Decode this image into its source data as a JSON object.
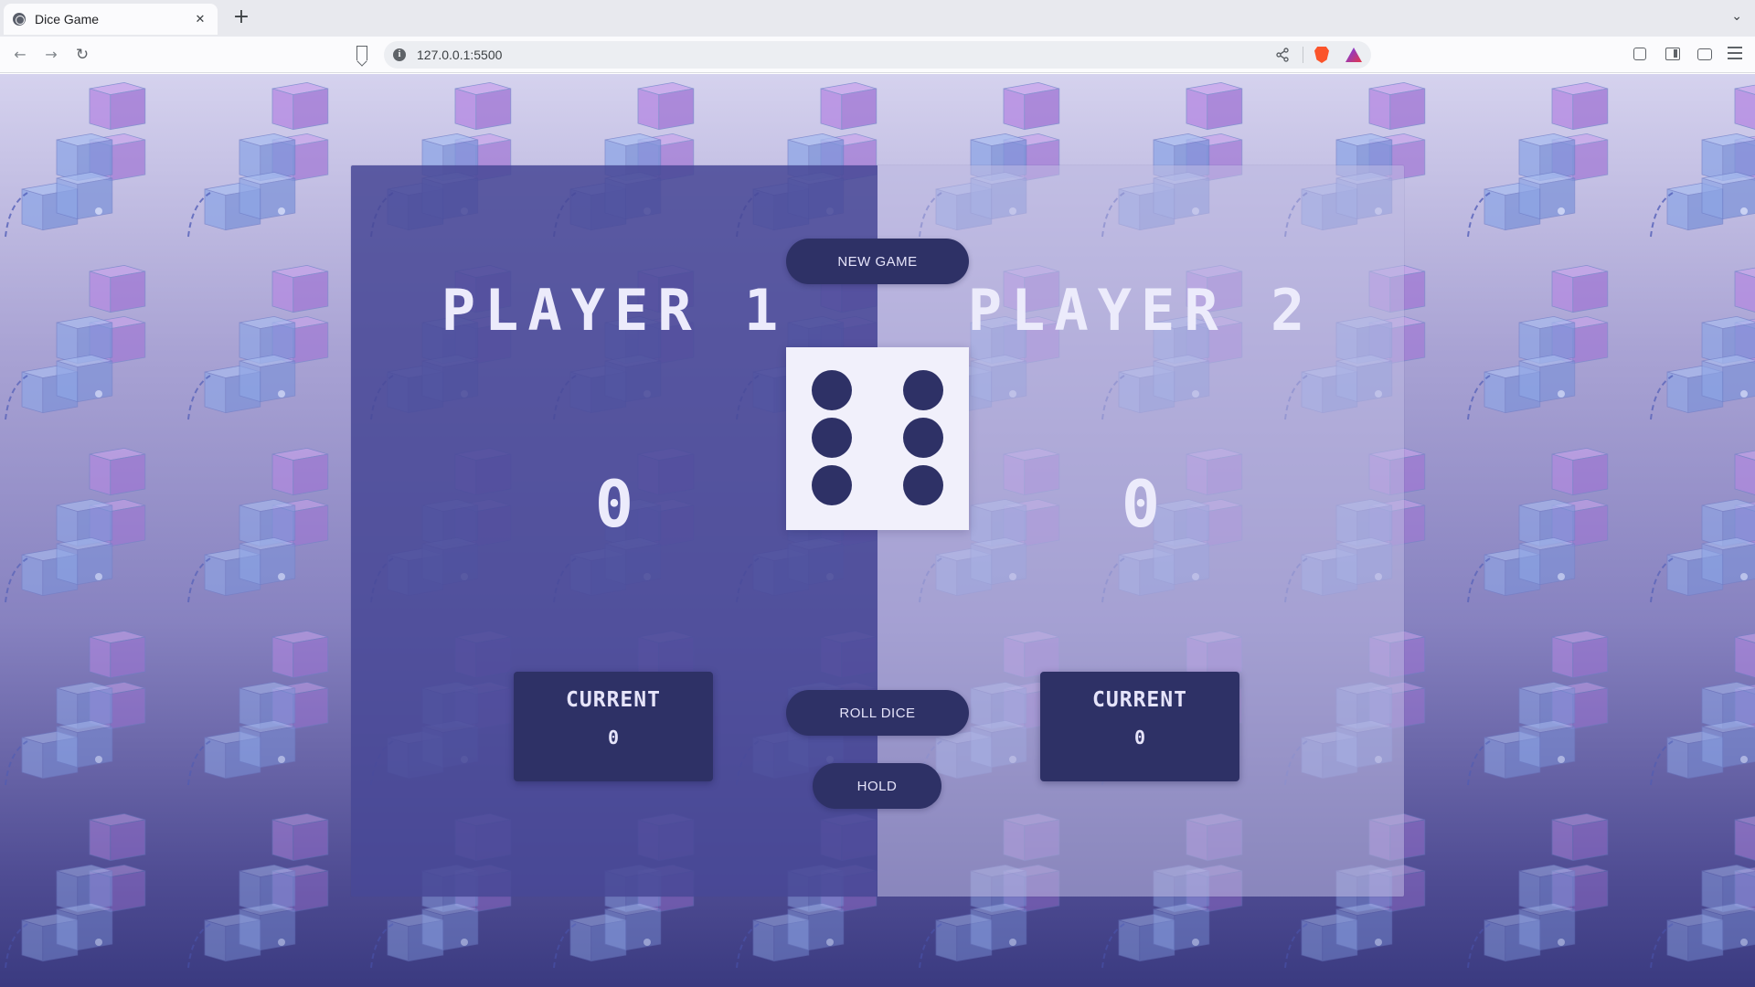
{
  "browser": {
    "tab_title": "Dice Game",
    "tab_close": "✕",
    "new_tab": "+",
    "url": "127.0.0.1:5500"
  },
  "game": {
    "new_game_label": "NEW GAME",
    "roll_dice_label": "ROLL DICE",
    "hold_label": "HOLD",
    "dice_value": 6,
    "players": [
      {
        "name": "PLAYER 1",
        "score": "0",
        "current_label": "CURRENT",
        "current_score": "0",
        "active": true
      },
      {
        "name": "PLAYER 2",
        "score": "0",
        "current_label": "CURRENT",
        "current_score": "0",
        "active": false
      }
    ]
  },
  "colors": {
    "button": "#2e3166",
    "active_panel": "#484896",
    "text_light": "#ecebfb"
  }
}
